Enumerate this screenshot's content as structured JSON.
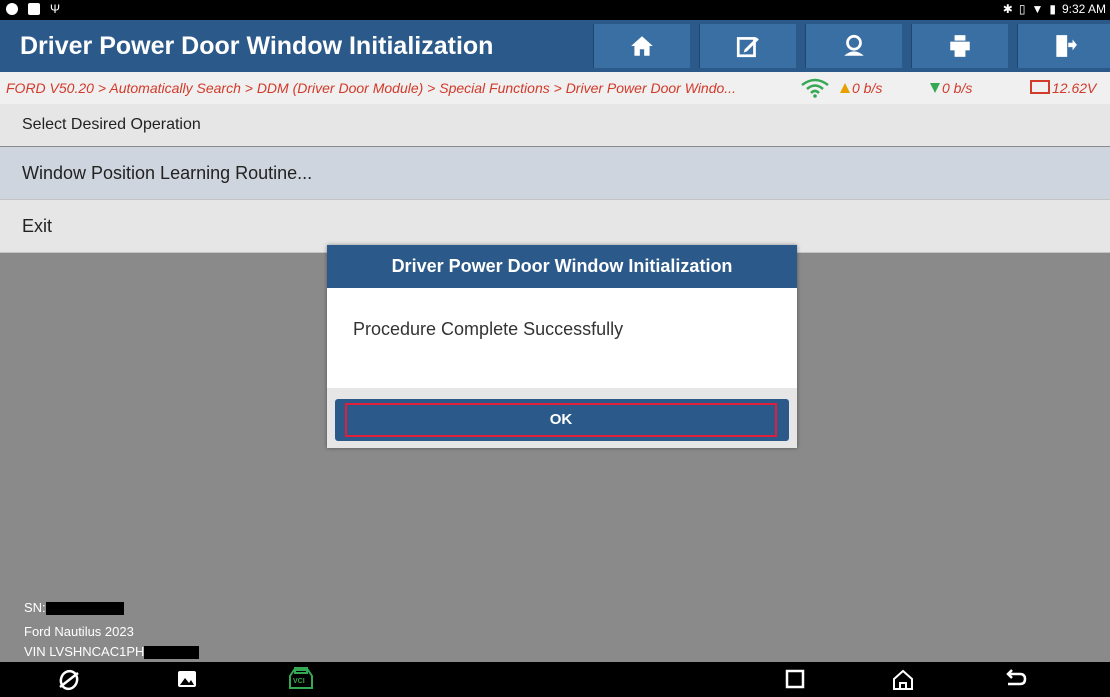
{
  "status_bar": {
    "time": "9:32 AM"
  },
  "header": {
    "title": "Driver Power Door Window Initialization",
    "buttons": [
      "home-icon",
      "edit-report-icon",
      "user-profile-icon",
      "print-icon",
      "exit-icon"
    ]
  },
  "breadcrumb": {
    "path": "FORD V50.20 > Automatically Search > DDM (Driver Door Module) > Special Functions > Driver Power Door Windo...",
    "upload_rate": "0 b/s",
    "download_rate": "0 b/s",
    "voltage": "12.62V"
  },
  "main": {
    "heading": "Select Desired Operation",
    "items": [
      {
        "label": "Window Position Learning Routine..."
      },
      {
        "label": "Exit"
      }
    ]
  },
  "footer": {
    "sn_label": "SN:",
    "vehicle": "Ford Nautilus 2023",
    "vin_prefix": "VIN LVSHNCAC1PH"
  },
  "dialog": {
    "title": "Driver Power Door Window Initialization",
    "message": "Procedure Complete Successfully",
    "ok_label": "OK"
  },
  "nav": {
    "vci_label": "VCI"
  },
  "colors": {
    "header_blue": "#2b5a8a",
    "breadcrumb_red": "#d23a2a",
    "highlight_red": "#e0203a"
  }
}
